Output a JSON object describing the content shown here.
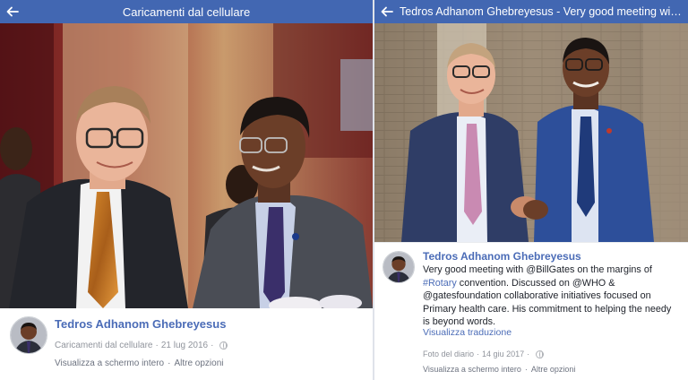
{
  "left_panel": {
    "header": {
      "title": "Caricamenti dal cellulare"
    },
    "post": {
      "author": "Tedros Adhanom Ghebreyesus",
      "album": "Caricamenti dal cellulare",
      "date": "21 lug 2016",
      "privacy_icon": "globe-icon",
      "actions": [
        "Visualizza a schermo intero",
        "Altre opzioni"
      ]
    }
  },
  "right_panel": {
    "header": {
      "title": "Tedros Adhanom Ghebreyesus - Very good meeting with @BillGates on the margins of #Rotary convention."
    },
    "post": {
      "author": "Tedros Adhanom Ghebreyesus",
      "text_parts": {
        "p1": "Very good meeting with @BillGates on the margins of ",
        "tag": "#Rotary",
        "p2": " convention. Discussed on @WHO & @gatesfoundation collaborative initiatives focused on Primary health care. His commitment to helping the needy is beyond words."
      },
      "translate": "Visualizza traduzione",
      "album": "Foto del diario",
      "date": "14 giu 2017",
      "privacy_icon": "globe-icon",
      "actions": [
        "Visualizza a schermo intero",
        "Altre opzioni"
      ]
    }
  },
  "colors": {
    "header_bar": "#4267b2",
    "author_link": "#4b6cb7",
    "meta_text": "#90949c"
  }
}
